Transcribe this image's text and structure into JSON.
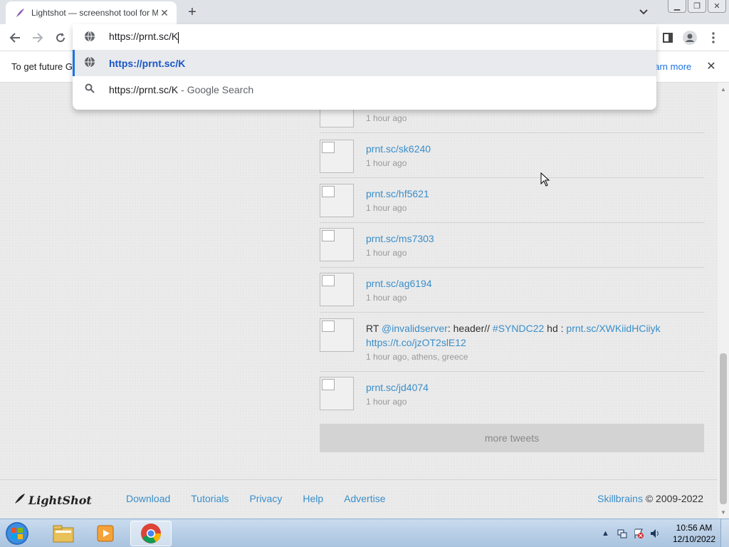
{
  "browser": {
    "tab_title": "Lightshot — screenshot tool for Mac & Win",
    "new_tab_label": "+"
  },
  "omnibox": {
    "value": "https://prnt.sc/K",
    "suggestions": [
      {
        "text": "https://prnt.sc/K",
        "subtext": ""
      },
      {
        "text": "https://prnt.sc/K",
        "subtext": " - Google Search"
      }
    ]
  },
  "infobar": {
    "text": "To get future G",
    "link": "earn more"
  },
  "tweets": [
    {
      "link": "",
      "time": "1 hour ago"
    },
    {
      "link": "prnt.sc/sk6240",
      "time": "1 hour ago"
    },
    {
      "link": "prnt.sc/hf5621",
      "time": "1 hour ago"
    },
    {
      "link": "prnt.sc/ms7303",
      "time": "1 hour ago"
    },
    {
      "link": "prnt.sc/ag6194",
      "time": "1 hour ago"
    },
    {
      "prefix": "RT ",
      "mention": "@invalidserver",
      "mid": ": header// ",
      "hashtag": "#SYNDC22",
      "mid2": " hd : ",
      "link": "prnt.sc/XWKiidHCiiyk",
      "url": "https://t.co/jzOT2slE12",
      "time": "1 hour ago, athens, greece"
    },
    {
      "link": "prnt.sc/jd4074",
      "time": "1 hour ago"
    }
  ],
  "more_tweets_label": "more tweets",
  "footer": {
    "logo": "LightShot",
    "nav": [
      "Download",
      "Tutorials",
      "Privacy",
      "Help",
      "Advertise"
    ],
    "company": "Skillbrains",
    "copyright": " © 2009-2022"
  },
  "taskbar": {
    "time": "10:56 AM",
    "date": "12/10/2022"
  },
  "colors": {
    "link": "#3a8ec9",
    "selected_suggestion": "#1a57c4",
    "accent": "#1a73e8"
  }
}
